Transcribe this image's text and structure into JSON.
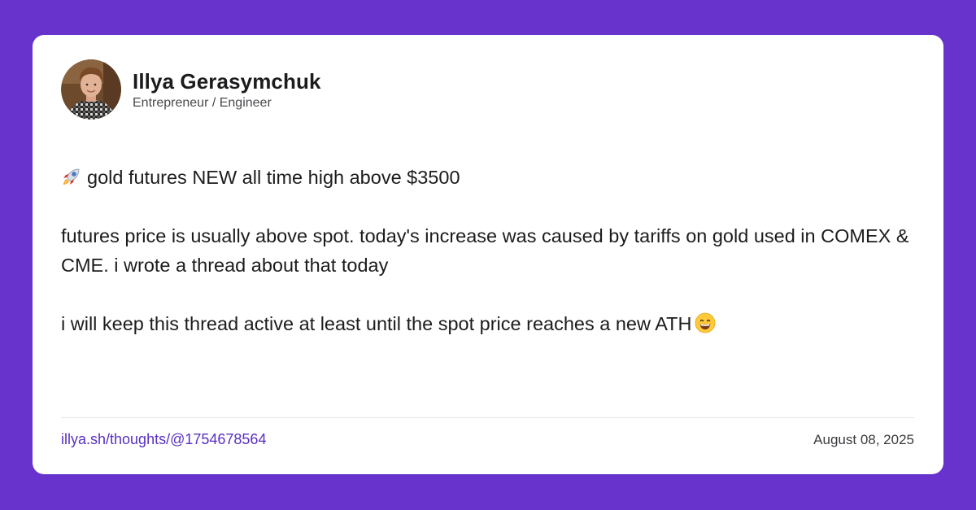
{
  "colors": {
    "background": "#6733cc",
    "card": "#ffffff",
    "link": "#5a2fc2",
    "text": "#1c1c1e"
  },
  "author": {
    "name": "Illya Gerasymchuk",
    "role": "Entrepreneur / Engineer",
    "avatar_icon": "avatar-photo"
  },
  "post": {
    "paragraphs": [
      {
        "icon": "rocket-emoji",
        "text": "gold futures NEW all time high above $3500"
      },
      {
        "text": "futures price is usually above spot. today's increase was caused by tariffs on gold used in COMEX & CME. i wrote a thread about that today"
      },
      {
        "text": "i will keep this thread active at least until the spot price reaches a new ATH",
        "trailing_icon": "grinning-face-emoji"
      }
    ]
  },
  "footer": {
    "link_text": "illya.sh/thoughts/@1754678564",
    "date": "August 08, 2025"
  }
}
